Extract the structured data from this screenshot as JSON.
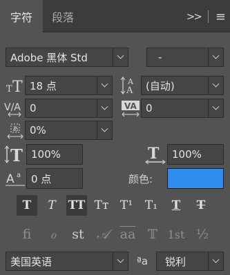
{
  "tabs": {
    "character": "字符",
    "paragraph": "段落"
  },
  "tab_icons": {
    "expand": ">>",
    "menu": "≡"
  },
  "font": {
    "family": "Adobe 黑体 Std",
    "style": "-"
  },
  "size": {
    "value": "18 点"
  },
  "leading": {
    "value": "(自动)"
  },
  "kerning": {
    "value": "0"
  },
  "tracking": {
    "value": "0"
  },
  "tsume": {
    "value": "0%"
  },
  "vertical_scale": {
    "value": "100%"
  },
  "horizontal_scale": {
    "value": "100%"
  },
  "baseline_shift": {
    "value": "0 点"
  },
  "color": {
    "label": "颜色:",
    "swatch": "#2d8ef0"
  },
  "type_styles": [
    "T",
    "T",
    "TT",
    "Tт",
    "T¹",
    "T₁",
    "T",
    "T"
  ],
  "opentype": [
    "ﬁ",
    "ℴ",
    "st",
    "𝒜",
    "aa",
    "𝕋",
    "1st",
    "½"
  ],
  "language": {
    "value": "美国英语"
  },
  "antialias": {
    "icon": "ªa",
    "value": "锐利"
  }
}
